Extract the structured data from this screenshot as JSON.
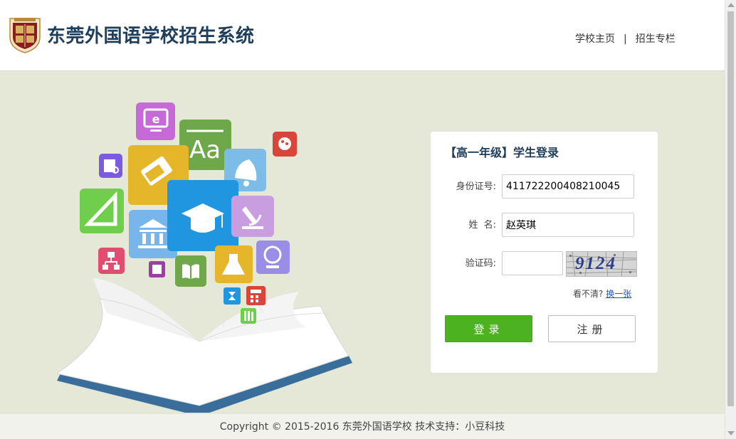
{
  "header": {
    "title": "东莞外国语学校招生系统",
    "nav": [
      {
        "label": "学校主页"
      },
      {
        "label": "招生专栏"
      }
    ],
    "separator": "|"
  },
  "login": {
    "title": "【高一年级】学生登录",
    "id_label": "身份证号:",
    "id_value": "411722200408210045",
    "name_label": "姓  名:",
    "name_value": "赵英琪",
    "captcha_label": "验证码:",
    "captcha_value": "",
    "captcha_text": "9124",
    "refresh_prompt": "看不清?",
    "refresh_link": "换一张",
    "login_button": "登录",
    "register_button": "注册"
  },
  "footer": {
    "copyright": "Copyright © 2015-2016 东莞外国语学校 技术支持：小豆科技"
  },
  "colors": {
    "header_title": "#1f3e5c",
    "main_background": "#e5e8d6",
    "login_button": "#4cb21f",
    "link": "#1a56c8"
  },
  "icons": [
    "school-crest-icon",
    "ebook-icon",
    "alphabet-icon",
    "pencil-icon",
    "bell-icon",
    "palette-icon",
    "library-icon",
    "ruler-icon",
    "graduation-cap-icon",
    "microscope-icon",
    "museum-icon",
    "network-icon",
    "globe-icon",
    "book-icon",
    "flask-icon",
    "hourglass-icon",
    "calculator-icon",
    "books-icon",
    "calendar-icon",
    "open-book-icon"
  ]
}
